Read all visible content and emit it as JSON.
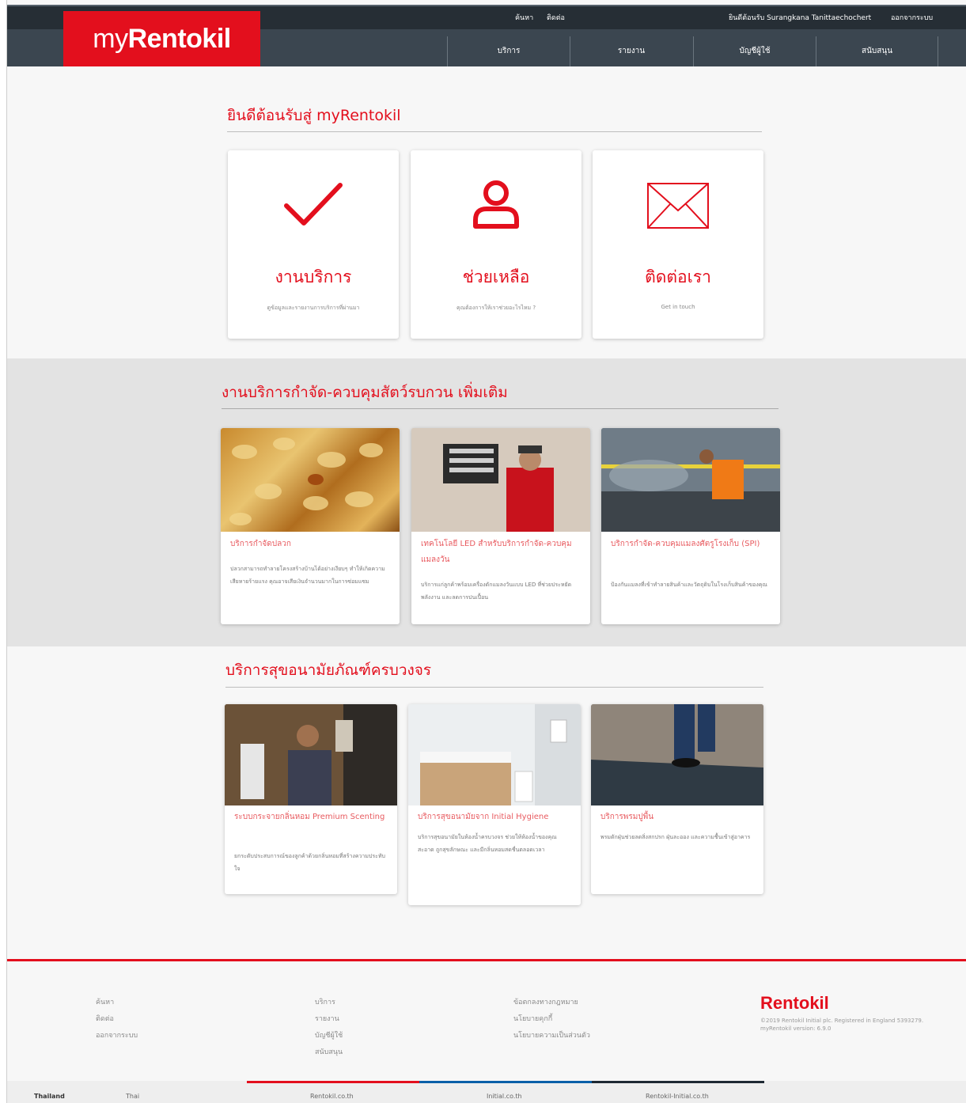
{
  "header": {
    "logo_prefix": "my",
    "logo_bold": "Rentokil",
    "top_links": [
      "ค้นหา",
      "ติดต่อ"
    ],
    "welcome": "ยินดีต้อนรับ Surangkana Tanittaechochert",
    "logout": "ออกจากระบบ",
    "nav": [
      "บริการ",
      "รายงาน",
      "บัญชีผู้ใช้",
      "สนับสนุน"
    ]
  },
  "welcome_section": {
    "title": "ยินดีต้อนรับสู่ myRentokil",
    "tiles": [
      {
        "icon": "checkmark-icon",
        "title": "งานบริการ",
        "subtitle": "ดูข้อมูลและรายงานการบริการที่ผ่านมา"
      },
      {
        "icon": "person-icon",
        "title": "ช่วยเหลือ",
        "subtitle": "คุณต้องการให้เราช่วยอะไรไหม ?"
      },
      {
        "icon": "envelope-icon",
        "title": "ติดต่อเรา",
        "subtitle": "Get in touch"
      }
    ]
  },
  "pest_section": {
    "title": "งานบริการกำจัด-ควบคุมสัตว์รบกวน เพิ่มเติม",
    "cards": [
      {
        "image": "termites-image",
        "title": "บริการกำจัดปลวก",
        "desc": "ปลวกสามารถทำลายโครงสร้างบ้านได้อย่างเงียบๆ ทำให้เกิดความเสียหายร้ายแรง คุณอาจเสียเงินจำนวนมากในการซ่อมแซม"
      },
      {
        "image": "led-fly-trap-image",
        "title": "เทคโนโลยี LED สำหรับบริการกำจัด-ควบคุมแมลงวัน",
        "desc": "บริการแก่ลูกค้าพร้อมเครื่องดักแมลงวันแบบ LED ที่ช่วยประหยัดพลังงาน และลดการปนเปื้อน"
      },
      {
        "image": "stored-product-pest-image",
        "title": "บริการกำจัด-ควบคุมแมลงศัตรูโรงเก็บ (SPI)",
        "desc": "ป้องกันแมลงที่เข้าทำลายสินค้าและวัตถุดิบในโรงเก็บสินค้าของคุณ"
      }
    ]
  },
  "hygiene_section": {
    "title": "บริการสุขอนามัยภัณฑ์ครบวงจร",
    "cards": [
      {
        "image": "scent-dispenser-image",
        "title": "ระบบกระจายกลิ่นหอม Premium Scenting",
        "desc": "ยกระดับประสบการณ์ของลูกค้าด้วยกลิ่นหอมที่สร้างความประทับใจ"
      },
      {
        "image": "washroom-image",
        "title": "บริการสุขอนามัยจาก Initial Hygiene",
        "desc": "บริการสุขอนามัยในห้องน้ำครบวงจร ช่วยให้ห้องน้ำของคุณสะอาด ถูกสุขลักษณะ และมีกลิ่นหอมสดชื่นตลอดเวลา"
      },
      {
        "image": "floor-mat-image",
        "title": "บริการพรมปูพื้น",
        "desc": "พรมดักฝุ่นช่วยลดสิ่งสกปรก ฝุ่นละออง และความชื้นเข้าสู่อาคาร"
      }
    ]
  },
  "footer": {
    "col1": [
      "ค้นหา",
      "ติดต่อ",
      "ออกจากระบบ"
    ],
    "col2": [
      "บริการ",
      "รายงาน",
      "บัญชีผู้ใช้",
      "สนับสนุน"
    ],
    "col3": [
      "ข้อตกลงทางกฎหมาย",
      "นโยบายคุกกี้",
      "นโยบายความเป็นส่วนตัว"
    ],
    "logo": "Rentokil",
    "copyright": "©2019 Rentokil Initial plc. Registered in England 5393279.",
    "version": "myRentokil version: 6.9.0"
  },
  "bottom_bar": {
    "country": "Thailand",
    "language": "Thai",
    "links": [
      "Rentokil.co.th",
      "Initial.co.th",
      "Rentokil-Initial.co.th"
    ]
  },
  "colors": {
    "brand_red": "#e30f1d",
    "header_dark": "#262e35",
    "nav": "#3b4650",
    "band_gray": "#e3e3e3"
  }
}
